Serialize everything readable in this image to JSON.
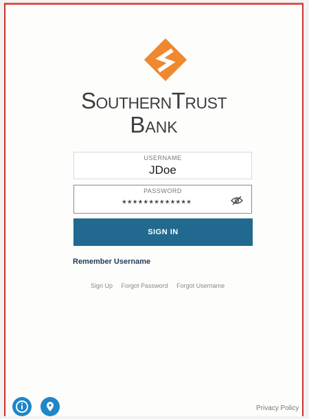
{
  "brand": {
    "line1": "SouthernTrust",
    "line2": "Bank",
    "logo_icon": "diamond-s-logo",
    "logo_color": "#f0882e"
  },
  "login_form": {
    "username_label": "USERNAME",
    "username_value": "JDoe",
    "password_label": "PASSWORD",
    "password_value": "*************",
    "password_toggle_icon": "eye-slash-icon",
    "signin_label": "SIGN IN",
    "signin_color": "#22698f"
  },
  "remember_username": "Remember Username",
  "links": {
    "sign_up": "Sign Up",
    "forgot_password": "Forgot Password",
    "forgot_username": "Forgot Username"
  },
  "footer": {
    "info_icon": "info-icon",
    "location_icon": "location-pin-icon",
    "privacy_policy": "Privacy Policy"
  }
}
